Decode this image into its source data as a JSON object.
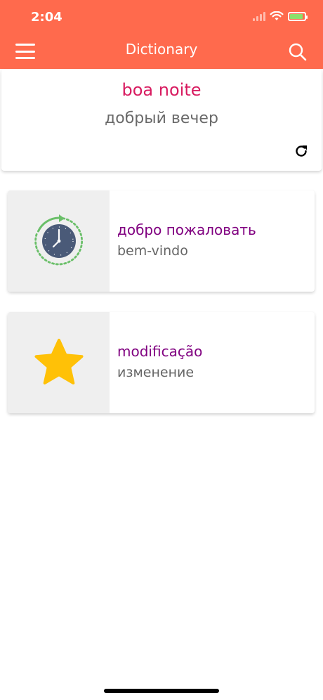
{
  "status": {
    "time": "2:04"
  },
  "header": {
    "title": "Dictionary",
    "menu_icon": "hamburger-menu-icon",
    "search_icon": "search-icon",
    "bg_color": "#ff6a4d"
  },
  "word_of_day": {
    "word": "boa noite",
    "translation": "добрый вечер",
    "refresh_icon": "refresh-icon"
  },
  "cards": [
    {
      "icon": "history-clock-icon",
      "primary": "добро пожаловать",
      "secondary": "bem-vindo"
    },
    {
      "icon": "star-icon",
      "primary": "modificação",
      "secondary": "изменение"
    }
  ],
  "colors": {
    "accent": "#ff6a4d",
    "word": "#d81b60",
    "card_primary": "#800080",
    "star": "#ffc107",
    "clock_face": "#4a5a78",
    "clock_arrow": "#6abf69"
  }
}
